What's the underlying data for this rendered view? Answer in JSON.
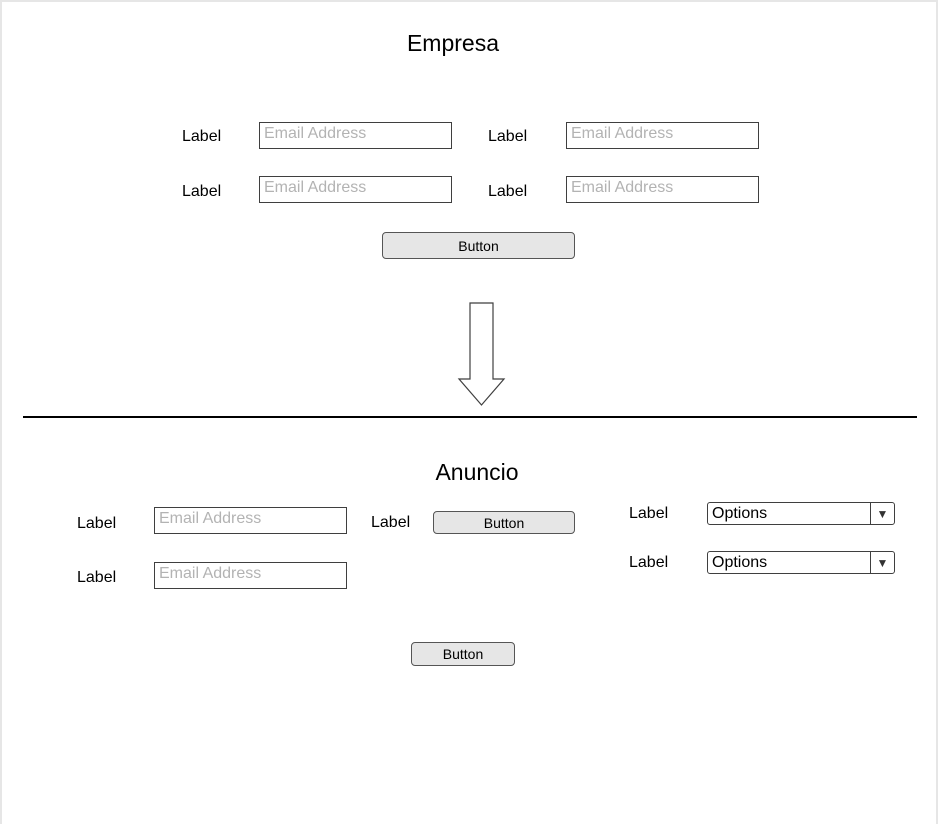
{
  "empresa": {
    "title": "Empresa",
    "fields": [
      {
        "label": "Label",
        "placeholder": "Email Address"
      },
      {
        "label": "Label",
        "placeholder": "Email Address"
      },
      {
        "label": "Label",
        "placeholder": "Email Address"
      },
      {
        "label": "Label",
        "placeholder": "Email Address"
      }
    ],
    "button_label": "Button"
  },
  "arrow_icon": "arrow-down-icon",
  "anuncio": {
    "title": "Anuncio",
    "fields": [
      {
        "label": "Label",
        "placeholder": "Email Address"
      },
      {
        "label": "Label",
        "placeholder": "Email Address"
      }
    ],
    "inline_button": {
      "label": "Label",
      "button_label": "Button"
    },
    "selects": [
      {
        "label": "Label",
        "value": "Options"
      },
      {
        "label": "Label",
        "value": "Options"
      }
    ],
    "button_label": "Button"
  }
}
